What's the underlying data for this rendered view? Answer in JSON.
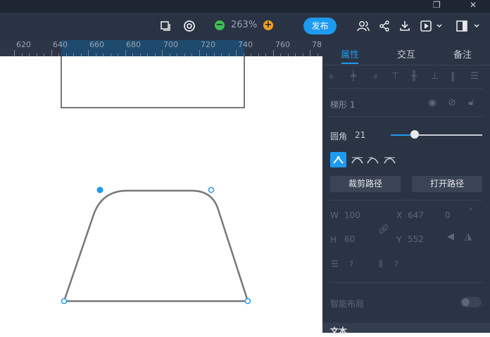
{
  "window": {
    "restore_glyph": "❐",
    "close_glyph": "✕"
  },
  "toolbar": {
    "zoom": "263%",
    "zoom_out": "−",
    "zoom_in": "+",
    "publish": "发布"
  },
  "ruler": {
    "ticks": [
      "620",
      "640",
      "660",
      "680",
      "700",
      "720",
      "740",
      "760",
      "78"
    ]
  },
  "panel": {
    "tabs": [
      "属性",
      "交互",
      "备注"
    ],
    "shape_name": "梯形 1",
    "corner_label": "圆角",
    "corner_value": "21",
    "corner_fraction": 0.26,
    "crop_path": "裁剪路径",
    "open_path": "打开路径",
    "w_label": "W",
    "w_value": "100",
    "h_label": "H",
    "h_value": "60",
    "x_label": "X",
    "x_value": "647",
    "y_label": "Y",
    "y_value": "552",
    "rotation": "0",
    "q1": "?",
    "q2": "?",
    "smart_layout": "智能布局",
    "text_section": "文本"
  },
  "colors": {
    "accent": "#1d9bf0",
    "panel_bg": "#2b3444",
    "toolbar_bg": "#2a3344",
    "shape_stroke": "#777777"
  }
}
